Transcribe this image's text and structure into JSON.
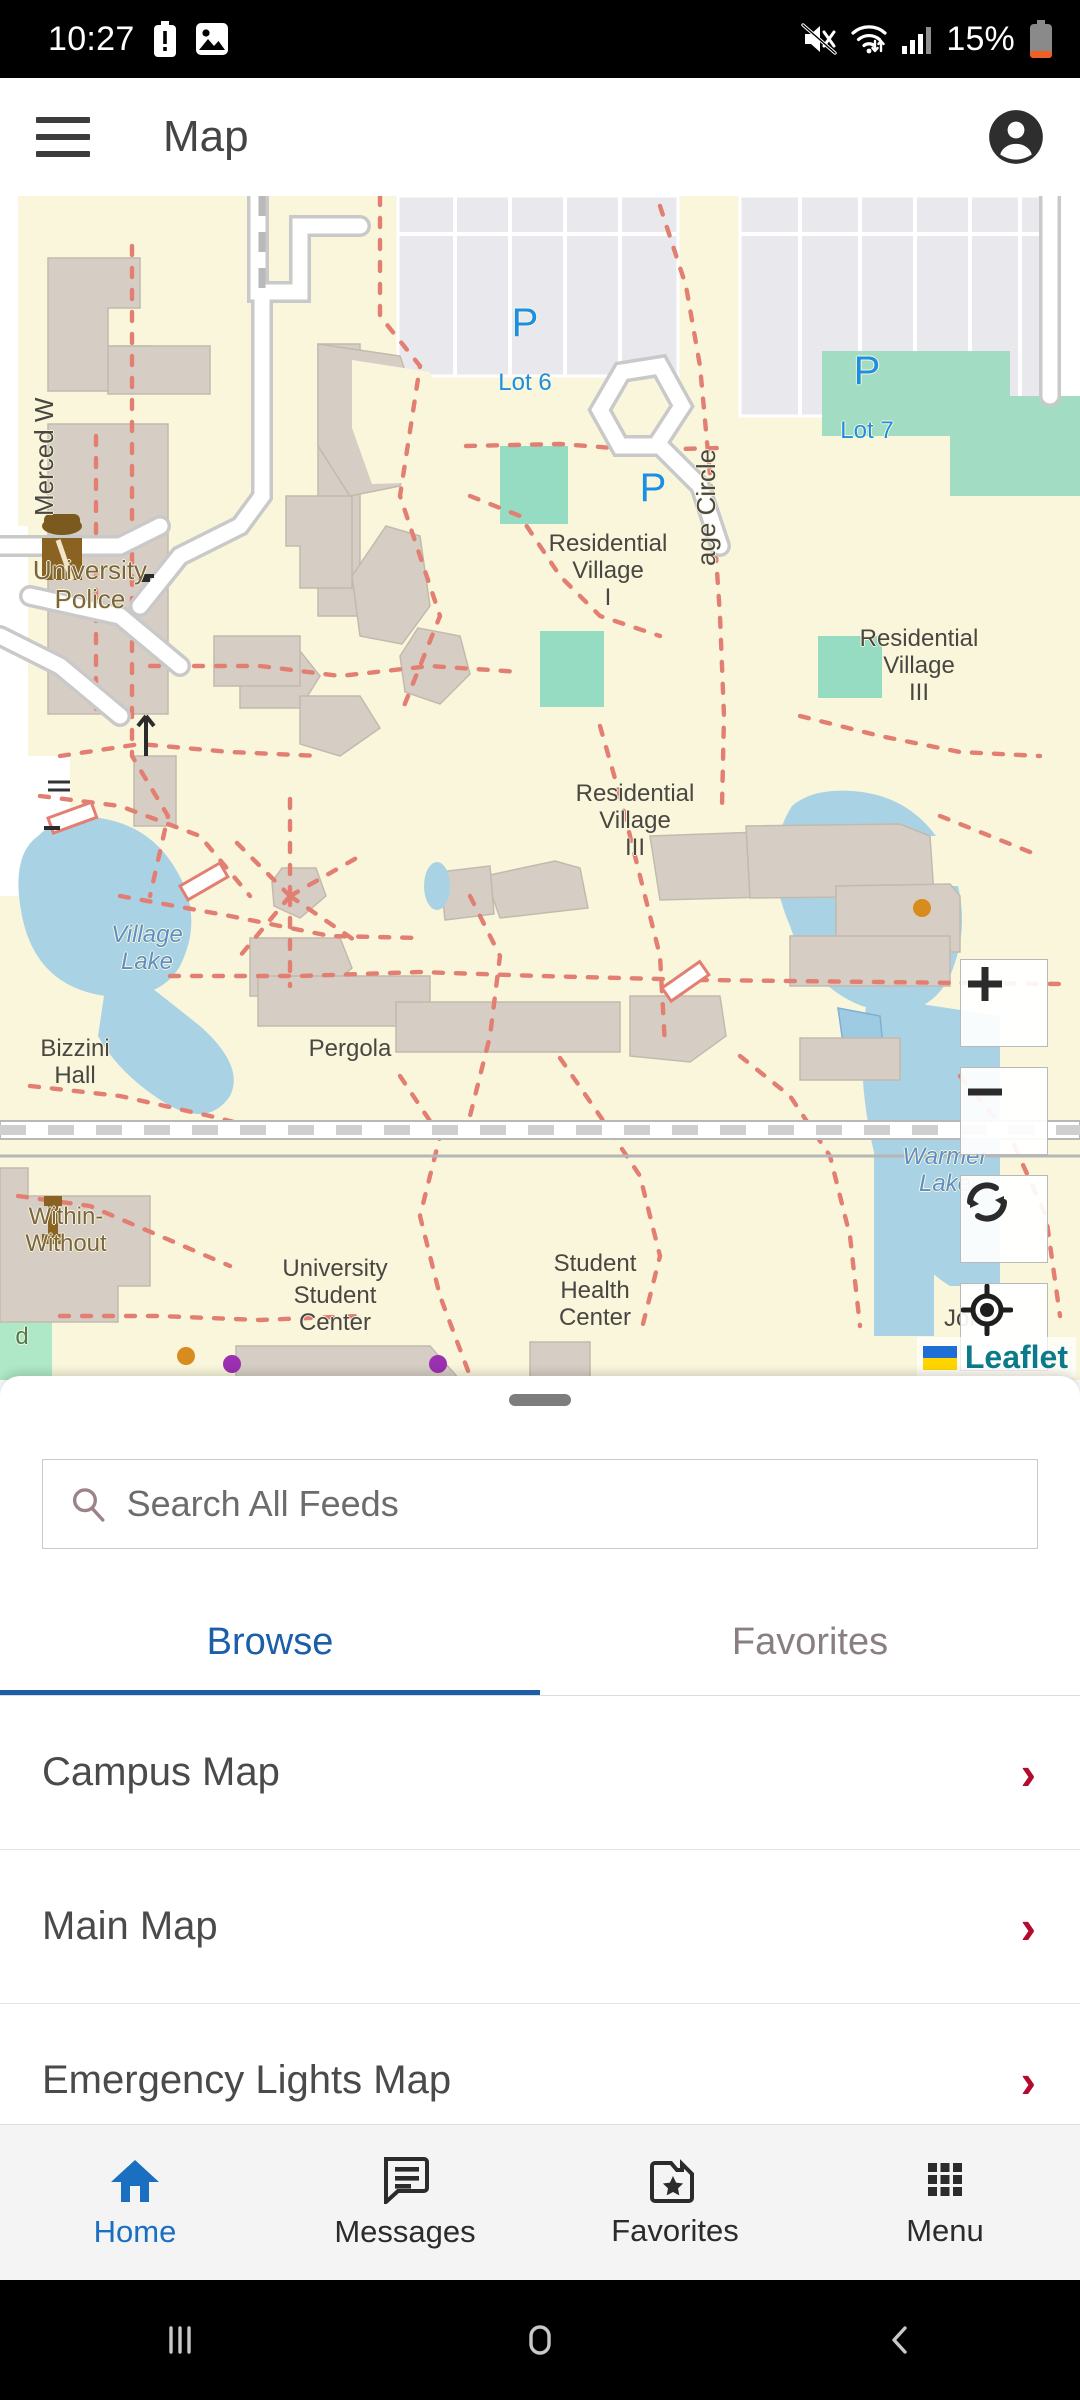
{
  "status_bar": {
    "time": "10:27",
    "battery_percent": "15%",
    "left_icons": [
      "battery-alert-icon",
      "image-icon"
    ],
    "right_icons": [
      "volume-mute-icon",
      "wifi-icon",
      "cellular-signal-icon",
      "battery-icon"
    ],
    "battery_accent": "#ef6024"
  },
  "app_bar": {
    "menu_icon": "hamburger-menu-icon",
    "title": "Map",
    "account_icon": "account-circle-icon"
  },
  "map": {
    "attribution": "Leaflet",
    "controls": [
      {
        "name": "zoom-in",
        "glyph": "+"
      },
      {
        "name": "zoom-out",
        "glyph": "−"
      },
      {
        "name": "refresh",
        "glyph": "refresh-icon"
      },
      {
        "name": "locate",
        "glyph": "crosshair-icon"
      }
    ],
    "labels": [
      {
        "text": "Merced W",
        "kind": "street-rotated"
      },
      {
        "text": "University\nPolice",
        "kind": "poi-brown"
      },
      {
        "text": "age Circle",
        "kind": "street-rotated"
      },
      {
        "text": "Lot 6",
        "kind": "parking"
      },
      {
        "text": "Lot 7",
        "kind": "parking"
      },
      {
        "text": "Residential\nVillage\nI",
        "kind": "building"
      },
      {
        "text": "Residential\nVillage\nIII",
        "kind": "building"
      },
      {
        "text": "Residential\nVillage\nIII",
        "kind": "building"
      },
      {
        "text": "Village\nLake",
        "kind": "water"
      },
      {
        "text": "Warmer\nLake",
        "kind": "water"
      },
      {
        "text": "Bizzini\nHall",
        "kind": "building"
      },
      {
        "text": "Pergola",
        "kind": "building"
      },
      {
        "text": "Within-\nWithout",
        "kind": "poi-brown"
      },
      {
        "text": "University\nStudent\nCenter",
        "kind": "building"
      },
      {
        "text": "Student\nHealth\nCenter",
        "kind": "building"
      },
      {
        "text": "John",
        "kind": "building"
      },
      {
        "text": "d",
        "kind": "park"
      }
    ],
    "parking_symbol": "P",
    "colors": {
      "background": "#f9f6dc",
      "building": "#d6cec4",
      "water": "#a9d3e5",
      "park": "#a8dfc8",
      "parking_lot": "#e8e8ed",
      "path": "#e27e72",
      "road": "#ffffff",
      "parking_text": "#1a8fe3"
    }
  },
  "sheet": {
    "search": {
      "placeholder": "Search All Feeds",
      "value": "",
      "icon": "search-icon"
    },
    "tabs": [
      {
        "label": "Browse",
        "active": true
      },
      {
        "label": "Favorites",
        "active": false
      }
    ],
    "items": [
      {
        "label": "Campus Map",
        "chevron": "›"
      },
      {
        "label": "Main Map",
        "chevron": "›"
      },
      {
        "label": "Emergency Lights Map",
        "chevron": "›"
      }
    ],
    "accent": "#1c5fa8",
    "chevron_color": "#b30a2e"
  },
  "bottom_nav": {
    "items": [
      {
        "label": "Home",
        "icon": "home-icon",
        "active": true
      },
      {
        "label": "Messages",
        "icon": "message-icon",
        "active": false
      },
      {
        "label": "Favorites",
        "icon": "folder-star-icon",
        "active": false
      },
      {
        "label": "Menu",
        "icon": "grid-menu-icon",
        "active": false
      }
    ],
    "active_color": "#1b6fc0"
  },
  "android_nav": {
    "items": [
      {
        "name": "recents-button",
        "glyph": "|||"
      },
      {
        "name": "home-button",
        "glyph": "▢"
      },
      {
        "name": "back-button",
        "glyph": "‹"
      }
    ]
  }
}
